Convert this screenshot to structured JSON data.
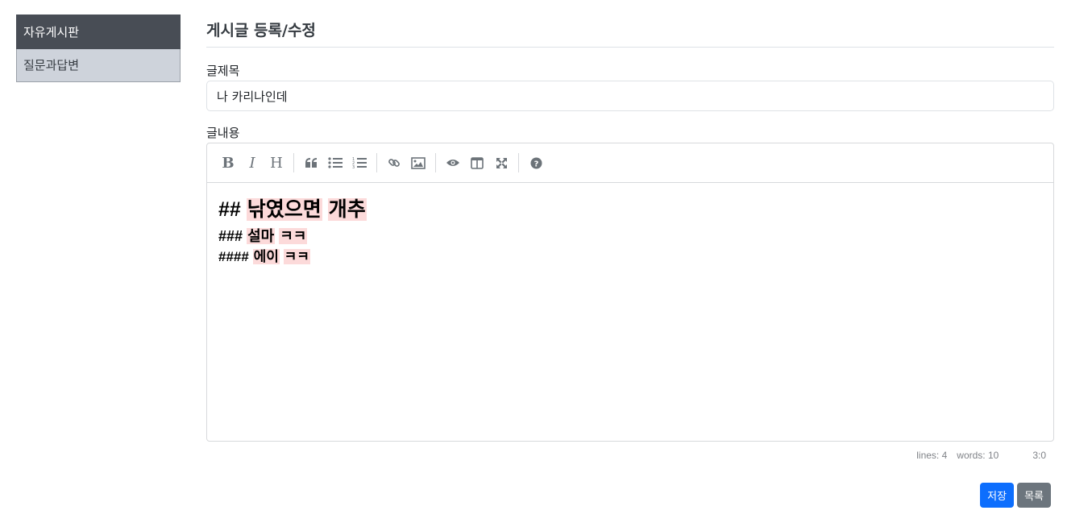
{
  "sidebar": {
    "items": [
      {
        "label": "자유게시판",
        "active": true
      },
      {
        "label": "질문과답변",
        "active": false
      }
    ]
  },
  "form": {
    "page_title": "게시글 등록/수정",
    "title_label": "글제목",
    "title_value": "나 카리나인데",
    "content_label": "글내용"
  },
  "editor": {
    "toolbar": [
      "bold-icon",
      "italic-icon",
      "heading-icon",
      "quote-icon",
      "unordered-list-icon",
      "ordered-list-icon",
      "link-icon",
      "image-icon",
      "preview-icon",
      "side-by-side-icon",
      "fullscreen-icon",
      "guide-icon"
    ],
    "lines": [
      {
        "marker": "##",
        "words": [
          "낚였으면",
          "개추"
        ]
      },
      {
        "marker": "###",
        "words": [
          "설마",
          "ㅋㅋ"
        ]
      },
      {
        "marker": "####",
        "words": [
          "에이",
          "ㅋㅋ"
        ]
      }
    ],
    "status": {
      "lines": "lines: 4",
      "words": "words: 10",
      "cursor": "3:0"
    },
    "highlight_color": "#fcdada"
  },
  "actions": {
    "save_label": "저장",
    "list_label": "목록"
  },
  "colors": {
    "primary": "#0d6efd",
    "secondary": "#6c757d",
    "sidebar_active": "#484d55",
    "sidebar_item": "#ced3db"
  }
}
